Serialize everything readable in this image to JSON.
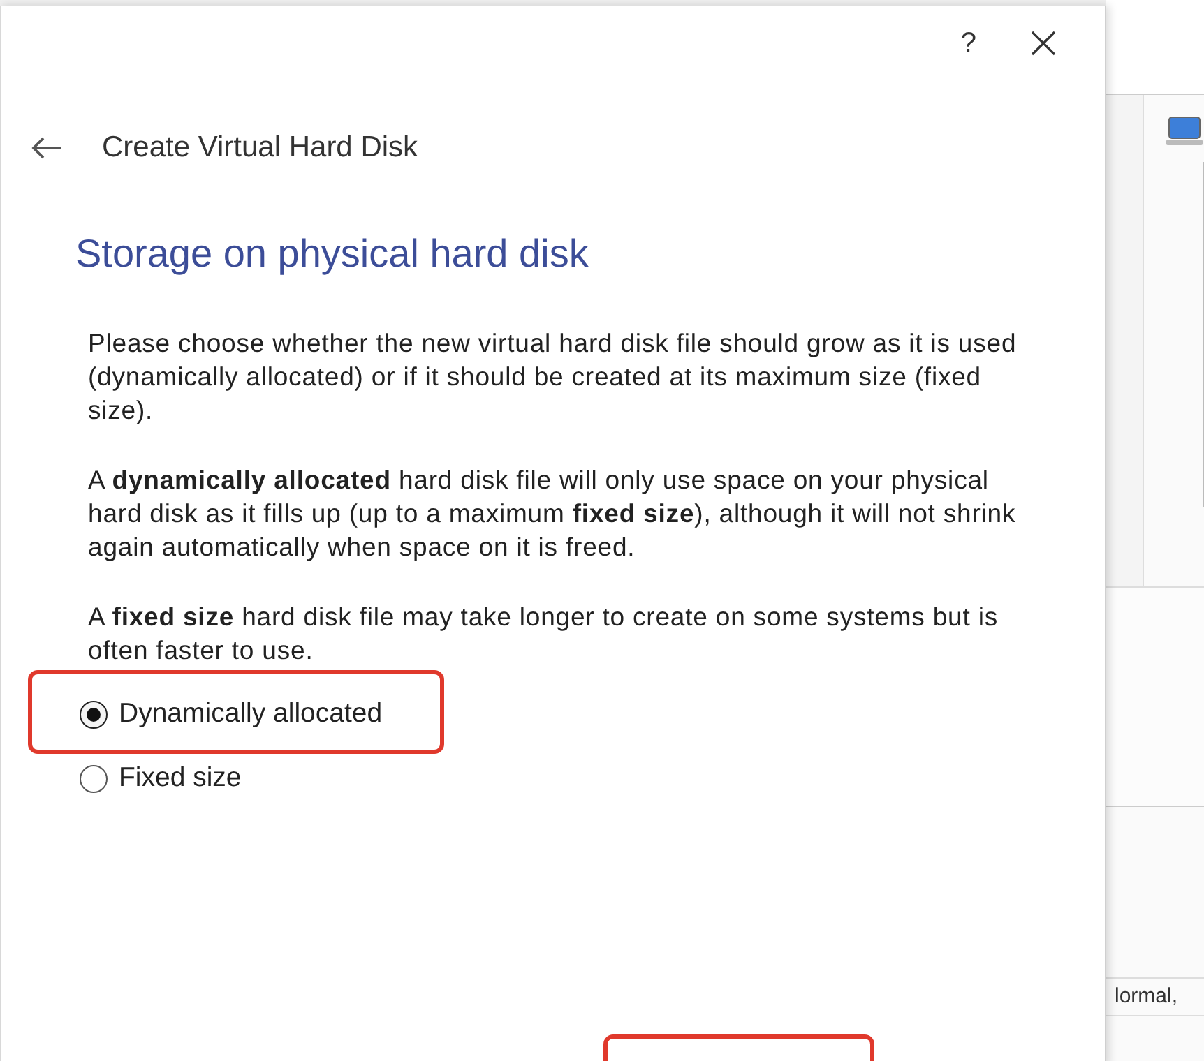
{
  "dialog": {
    "help": "?",
    "title": "Create Virtual Hard Disk",
    "heading": "Storage on physical hard disk",
    "paragraphs": [
      "Please choose whether the new virtual hard disk file should grow as it is used (dynamically allocated) or if it should be created at its maximum size (fixed size).",
      "A **dynamically allocated** hard disk file will only use space on your physical hard disk as it fills up (up to a maximum **fixed size**), although it will not shrink again automatically when space on it is freed.",
      "A **fixed size** hard disk file may take longer to create on some systems but is often faster to use."
    ],
    "options": [
      {
        "label": "Dynamically allocated",
        "selected": true,
        "highlighted": true
      },
      {
        "label": "Fixed size",
        "selected": false,
        "highlighted": false
      }
    ],
    "footer_highlighted": true
  },
  "background_window": {
    "status_text": "lormal,"
  }
}
